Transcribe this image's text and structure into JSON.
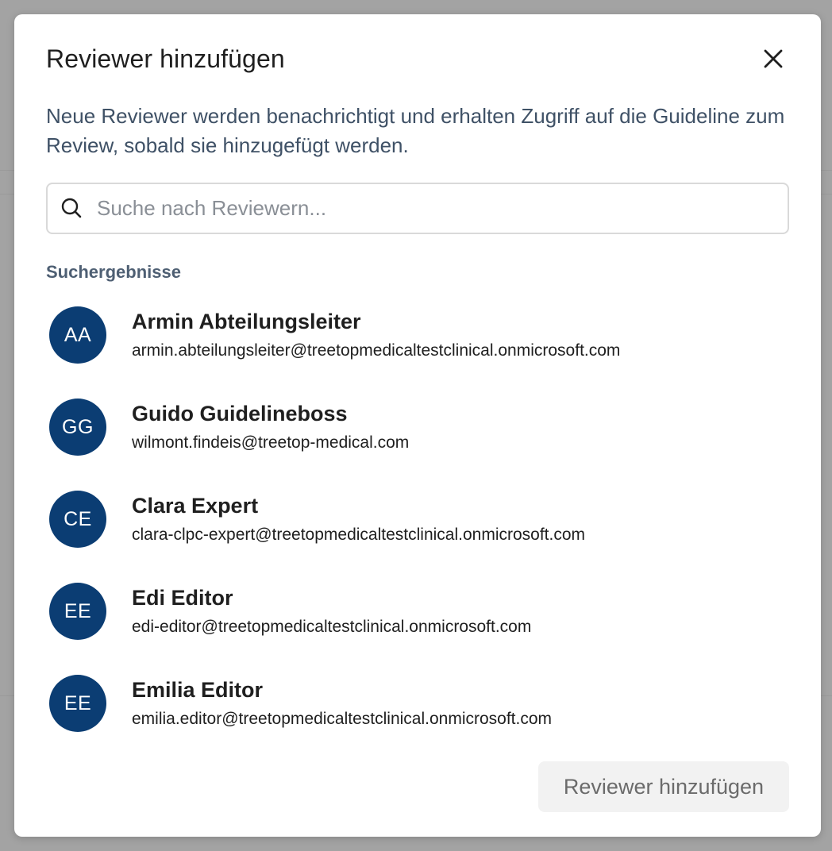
{
  "dialog": {
    "title": "Reviewer hinzufügen",
    "close_icon": "close-icon",
    "description": "Neue Reviewer werden benachrichtigt und erhalten Zugriff auf die Guideline zum Review, sobald sie hinzugefügt werden.",
    "search": {
      "icon": "search-icon",
      "value": "",
      "placeholder": "Suche nach Reviewern..."
    },
    "results_label": "Suchergebnisse",
    "results": [
      {
        "initials": "AA",
        "name": "Armin Abteilungsleiter",
        "email": "armin.abteilungsleiter@treetopmedicaltestclinical.onmicrosoft.com"
      },
      {
        "initials": "GG",
        "name": "Guido Guidelineboss",
        "email": "wilmont.findeis@treetop-medical.com"
      },
      {
        "initials": "CE",
        "name": "Clara Expert",
        "email": "clara-clpc-expert@treetopmedicaltestclinical.onmicrosoft.com"
      },
      {
        "initials": "EE",
        "name": "Edi Editor",
        "email": "edi-editor@treetopmedicaltestclinical.onmicrosoft.com"
      },
      {
        "initials": "EE",
        "name": "Emilia Editor",
        "email": "emilia.editor@treetopmedicaltestclinical.onmicrosoft.com"
      }
    ],
    "submit_label": "Reviewer hinzufügen"
  },
  "colors": {
    "avatar_bg": "#0b3d73",
    "overlay": "#a3a3a3",
    "description_text": "#3f5166",
    "button_disabled_bg": "#f2f2f2",
    "button_disabled_text": "#6b6b6b"
  }
}
